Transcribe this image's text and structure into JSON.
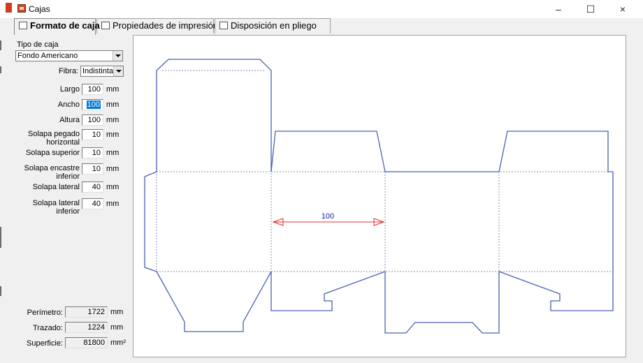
{
  "window": {
    "title": "Cajas",
    "minimize_glyph": "–",
    "maximize_glyph": "☐",
    "close_glyph": "×"
  },
  "tabs": [
    {
      "label": "Formato de caja",
      "icon": "box-format-icon",
      "active": true
    },
    {
      "label": "Propiedades de impresión",
      "icon": "printer-properties-icon",
      "active": false
    },
    {
      "label": "Disposición en pliego",
      "icon": "sheet-layout-icon",
      "active": false
    }
  ],
  "form": {
    "tipo_label": "Tipo de caja",
    "tipo_value": "Fondo Americano",
    "fibra_label": "Fibra:",
    "fibra_value": "Indistinta",
    "fields": [
      {
        "label": "Largo",
        "value": "100",
        "unit": "mm"
      },
      {
        "label": "Ancho",
        "value": "100",
        "unit": "mm",
        "selected": true
      },
      {
        "label": "Altura",
        "value": "100",
        "unit": "mm"
      },
      {
        "label": "Solapa pegado horizontal",
        "value": "10",
        "unit": "mm"
      },
      {
        "label": "Solapa superior",
        "value": "10",
        "unit": "mm"
      },
      {
        "label": "Solapa encastre inferior",
        "value": "10",
        "unit": "mm"
      },
      {
        "label": "Solapa lateral",
        "value": "40",
        "unit": "mm"
      },
      {
        "label": "Solapa lateral inferior",
        "value": "40",
        "unit": "mm"
      }
    ],
    "totals": [
      {
        "label": "Perímetro:",
        "value": "1722",
        "unit": "mm"
      },
      {
        "label": "Trazado:",
        "value": "1224",
        "unit": "mm"
      },
      {
        "label": "Superficie:",
        "value": "81800",
        "unit": "mm²"
      }
    ]
  },
  "drawing": {
    "dimension_label": "100",
    "cut_color": "#4a5fb8",
    "crease_color": "#8a8fb8",
    "dimension_color": "#e03030",
    "dimension_text_color": "#1a1aa0"
  }
}
